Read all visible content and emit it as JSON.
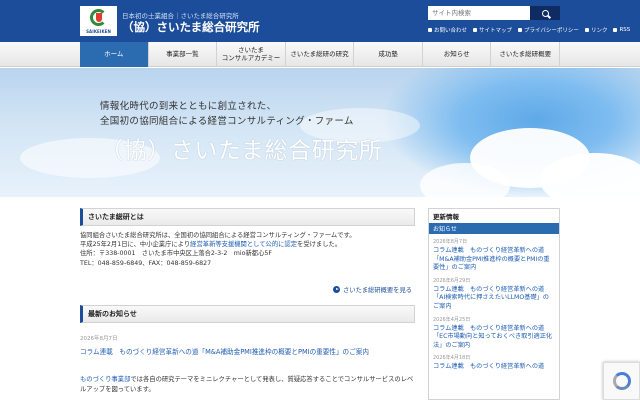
{
  "header": {
    "logo_text": "SAIKEIKEN",
    "tagline": "日本初の士業組合｜さいたま総合研究所",
    "sitename": "（協）さいたま総合研究所",
    "search_placeholder": "サイト内検索",
    "util_links": [
      "お問い合わせ",
      "サイトマップ",
      "プライバシーポリシー",
      "リンク",
      "RSS"
    ]
  },
  "nav": {
    "items": [
      "ホーム",
      "事業部一覧",
      "さいたま\nコンサルアカデミー",
      "さいたま総研の研究",
      "成功塾",
      "お知らせ",
      "さいたま総研概要"
    ]
  },
  "hero": {
    "line1": "情報化時代の到来とともに創立された、",
    "line2": "全国初の協同組合による経営コンサルティング・ファーム",
    "title": "（協）さいたま総合研究所"
  },
  "about": {
    "heading": "さいたま総研とは",
    "p1": "協同組合さいたま総合研究所は、全国初の協同組合による経営コンサルティング・ファームです。",
    "p2_pre": "平成25年2月1日に、中小企業庁により",
    "p2_link": "経営革新等支援機関として公的に認定",
    "p2_post": "を受けました。",
    "address": "住所：〒338-0001　さいたま市中央区上落合2-3-2　mio新都心5F",
    "tel": "TEL：048-859-6849、FAX：048-859-6827",
    "more": "さいたま総研概要を見る"
  },
  "news": {
    "heading": "最新のお知らせ",
    "date": "2026年8月7日",
    "title": "コラム連載　ものづくり経営革新への道「M&A補助金PMI推進枠の概要とPMIの重要性」のご案内",
    "body_link": "ものづくり事業部",
    "body_text": "では各自の研究テーマをミニレクチャーとして発表し、質疑応答することでコンサルサービスのレベルアップを図っています。"
  },
  "sidebar": {
    "heading": "更新情報",
    "tab": "お知らせ",
    "items": [
      {
        "date": "2026年8月7日",
        "title": "コラム連載　ものづくり経営革新への道「M&A補助金PMI推進枠の概要とPMIの重要性」のご案内"
      },
      {
        "date": "2026年6月29日",
        "title": "コラム連載　ものづくり経営革新への道「AI検索時代に押さえたいLLMO基礎」のご案内"
      },
      {
        "date": "2026年4月25日",
        "title": "コラム連載　ものづくり経営革新への道「EC市場動向と知っておくべき取引適正化法」のご案内"
      },
      {
        "date": "2026年4月18日",
        "title": "コラム連載　ものづくり経営革新への道"
      }
    ]
  }
}
